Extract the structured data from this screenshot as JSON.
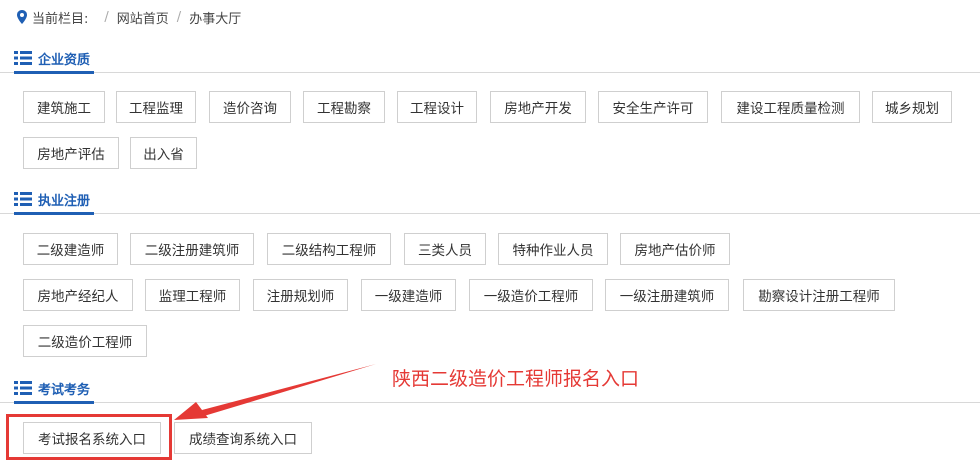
{
  "breadcrumb": {
    "prefix": "当前栏目:",
    "items": [
      "网站首页",
      "办事大厅"
    ]
  },
  "sections": [
    {
      "title": "企业资质",
      "buttons": [
        "建筑施工",
        "工程监理",
        "造价咨询",
        "工程勘察",
        "工程设计",
        "房地产开发",
        "安全生产许可",
        "建设工程质量检测",
        "城乡规划",
        "房地产评估",
        "出入省"
      ]
    },
    {
      "title": "执业注册",
      "buttons": [
        "二级建造师",
        "二级注册建筑师",
        "二级结构工程师",
        "三类人员",
        "特种作业人员",
        "房地产估价师",
        "房地产经纪人",
        "监理工程师",
        "注册规划师",
        "一级建造师",
        "一级造价工程师",
        "一级注册建筑师",
        "勘察设计注册工程师",
        "二级造价工程师"
      ]
    },
    {
      "title": "考试考务",
      "buttons": [
        "考试报名系统入口",
        "成绩查询系统入口"
      ]
    }
  ],
  "annotation": {
    "text": "陕西二级造价工程师报名入口",
    "color": "#e53935"
  },
  "colors": {
    "accent": "#1f5fb4",
    "annotation": "#e53935"
  },
  "icons": {
    "breadcrumb": "location-pin-icon",
    "section": "list-icon"
  }
}
